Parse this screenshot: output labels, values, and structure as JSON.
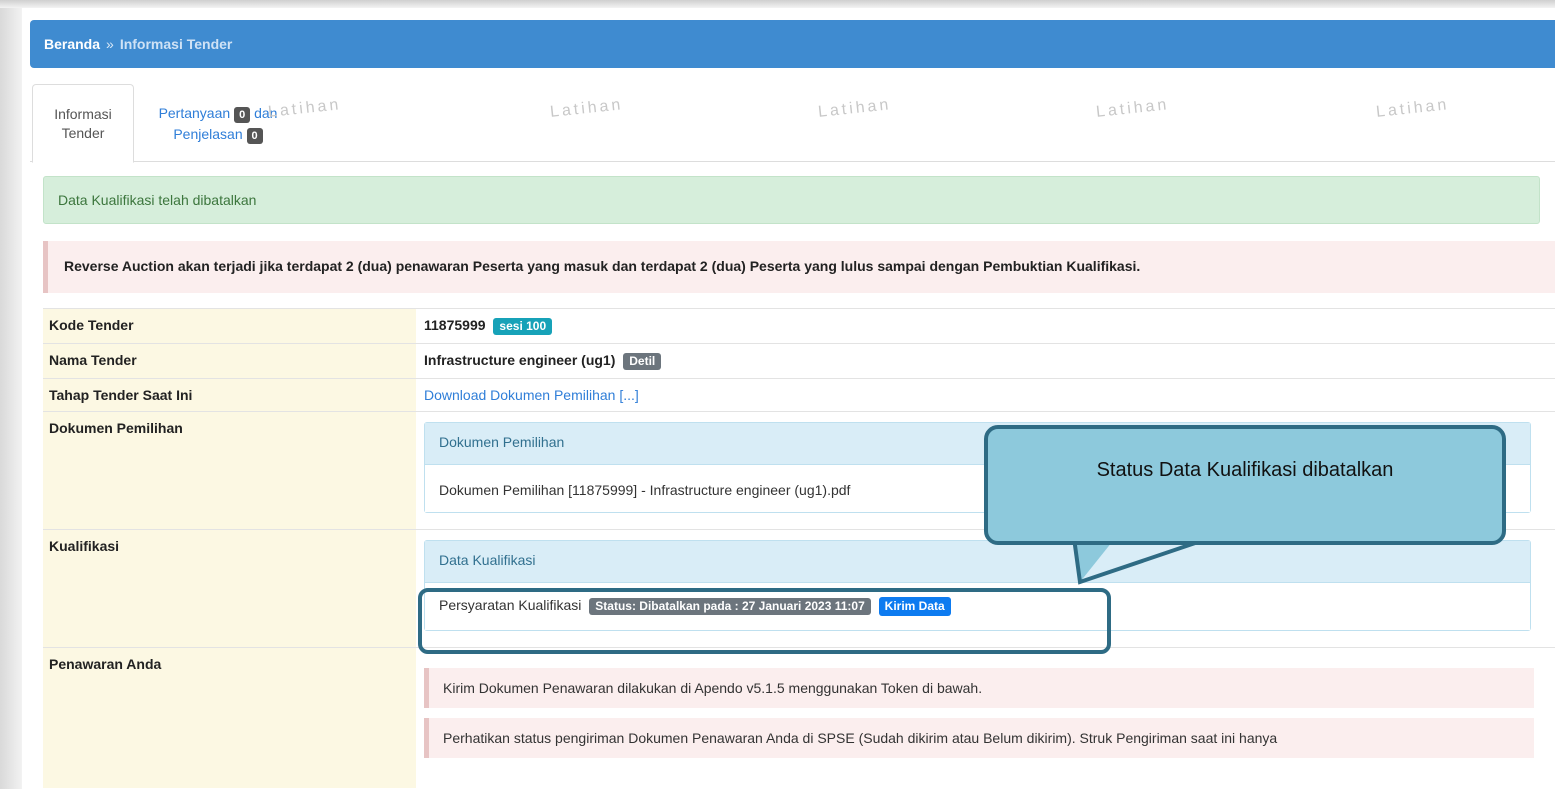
{
  "breadcrumb": {
    "home": "Beranda",
    "separator": "»",
    "current": "Informasi Tender"
  },
  "tabs": {
    "active": {
      "line1": "Informasi",
      "line2": "Tender"
    },
    "questions": {
      "line1a": "Pertanyaan",
      "count1": "0",
      "line1b": "dan",
      "line2a": "Penjelasan",
      "count2": "0"
    }
  },
  "watermark_text": "Latihan",
  "alerts": {
    "success": "Data Kualifikasi telah dibatalkan",
    "warning": "Reverse Auction akan terjadi jika terdapat 2 (dua) penawaran Peserta yang masuk dan terdapat 2 (dua) Peserta yang lulus sampai dengan Pembuktian Kualifikasi."
  },
  "rows": {
    "kode": {
      "label": "Kode Tender",
      "value": "11875999",
      "badge": "sesi 100"
    },
    "nama": {
      "label": "Nama Tender",
      "value": "Infrastructure engineer (ug1)",
      "badge": "Detil"
    },
    "tahap": {
      "label": "Tahap Tender Saat Ini",
      "value": "Download Dokumen Pemilihan [...]"
    },
    "dokumen": {
      "label": "Dokumen Pemilihan",
      "panel_title": "Dokumen Pemilihan",
      "file": "Dokumen Pemilihan [11875999] - Infrastructure engineer (ug1).pdf"
    },
    "kualifikasi": {
      "label": "Kualifikasi",
      "panel_title": "Data Kualifikasi",
      "item": "Persyaratan Kualifikasi",
      "status": "Status: Dibatalkan pada : 27 Januari 2023 11:07",
      "action": "Kirim Data"
    },
    "penawaran": {
      "label": "Penawaran Anda",
      "note1": "Kirim Dokumen Penawaran dilakukan di Apendo v5.1.5 menggunakan Token di bawah.",
      "note2": "Perhatikan status pengiriman Dokumen Penawaran Anda di SPSE (Sudah dikirim atau Belum dikirim). Struk Pengiriman saat ini hanya"
    }
  },
  "annotation": {
    "callout": "Status Data Kualifikasi dibatalkan"
  },
  "colors": {
    "header_blue": "#3f8bd0",
    "callout_fill": "#8dc9dc",
    "callout_border": "#2e6b84"
  }
}
